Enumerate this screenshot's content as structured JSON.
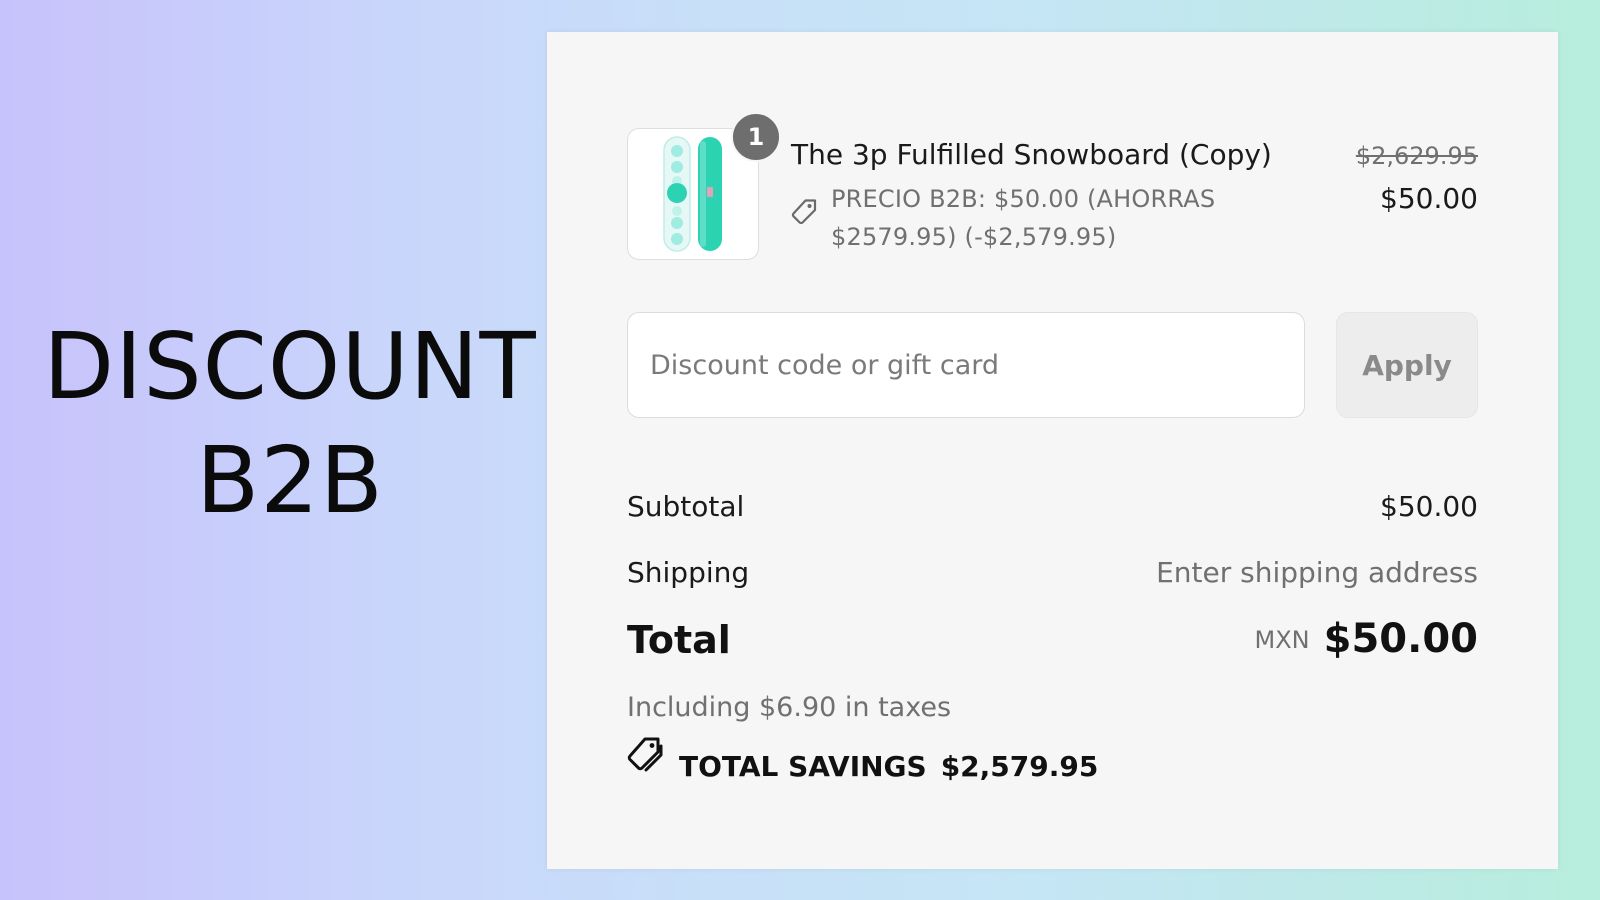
{
  "promo": {
    "line1": "DISCOUNT",
    "line2": "B2B"
  },
  "cart": {
    "item": {
      "quantity": "1",
      "name": "The 3p Fulfilled Snowboard (Copy)",
      "discount_description": "PRECIO B2B: $50.00 (AHORRAS $2579.95) (-$2,579.95)",
      "original_price": "$2,629.95",
      "price": "$50.00",
      "image_icon": "snowboard-image",
      "colors": {
        "board_primary": "#2cd3b3",
        "board_light": "#9fece0"
      }
    },
    "discount": {
      "placeholder": "Discount code or gift card",
      "value": "",
      "apply_label": "Apply"
    },
    "summary": {
      "subtotal_label": "Subtotal",
      "subtotal_value": "$50.00",
      "shipping_label": "Shipping",
      "shipping_value": "Enter shipping address",
      "total_label": "Total",
      "currency": "MXN",
      "total_value": "$50.00",
      "taxes_text": "Including $6.90 in taxes",
      "savings_label": "TOTAL SAVINGS",
      "savings_value": "$2,579.95"
    }
  },
  "icons": {
    "tag": "tag-icon",
    "savings": "savings-tag-icon"
  }
}
